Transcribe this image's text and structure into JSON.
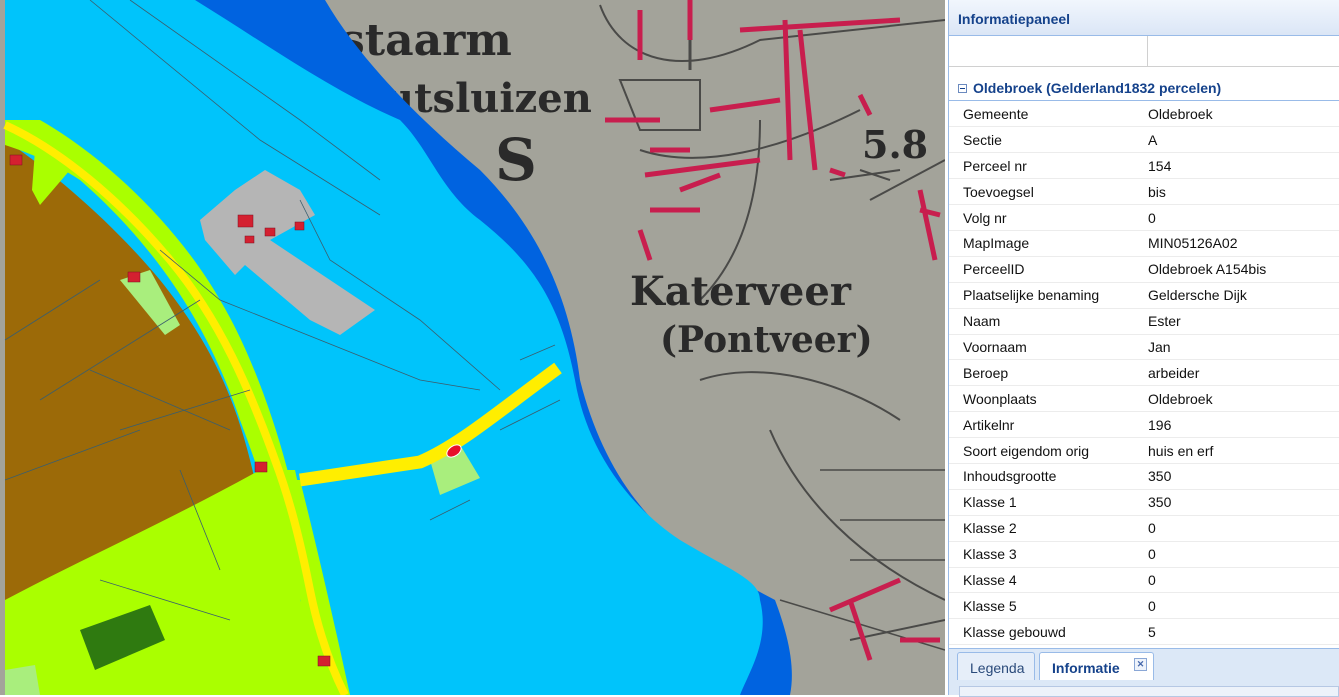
{
  "panel": {
    "title": "Informatiepaneel",
    "group_title": "Oldebroek (Gelderland1832 percelen)",
    "rows": [
      {
        "key": "Gemeente",
        "value": "Oldebroek"
      },
      {
        "key": "Sectie",
        "value": "A"
      },
      {
        "key": "Perceel nr",
        "value": "154"
      },
      {
        "key": "Toevoegsel",
        "value": "bis"
      },
      {
        "key": "Volg nr",
        "value": "0"
      },
      {
        "key": "MapImage",
        "value": "MIN05126A02"
      },
      {
        "key": "PerceelID",
        "value": "Oldebroek A154bis"
      },
      {
        "key": "Plaatselijke benaming",
        "value": "Geldersche Dijk"
      },
      {
        "key": "Naam",
        "value": "Ester"
      },
      {
        "key": "Voornaam",
        "value": "Jan"
      },
      {
        "key": "Beroep",
        "value": "arbeider"
      },
      {
        "key": "Woonplaats",
        "value": "Oldebroek"
      },
      {
        "key": "Artikelnr",
        "value": "196"
      },
      {
        "key": "Soort eigendom orig",
        "value": "huis en erf"
      },
      {
        "key": "Inhoudsgrootte",
        "value": "350"
      },
      {
        "key": "Klasse 1",
        "value": "350"
      },
      {
        "key": "Klasse 2",
        "value": "0"
      },
      {
        "key": "Klasse 3",
        "value": "0"
      },
      {
        "key": "Klasse 4",
        "value": "0"
      },
      {
        "key": "Klasse 5",
        "value": "0"
      },
      {
        "key": "Klasse gebouwd",
        "value": "5"
      }
    ]
  },
  "tabs": {
    "legenda": "Legenda",
    "informatie": "Informatie",
    "close_icon": "close-icon"
  },
  "map": {
    "labels": {
      "top_left": "staarm",
      "sluizen": "utsluizen",
      "letter": "S",
      "number": "5.8",
      "place1": "Katerveer",
      "place2": "(Pontveer)"
    },
    "colors": {
      "water": "#00c4fb",
      "river": "#0063e0",
      "road": "#ffee00",
      "farmland": "#9c6a08",
      "grassland": "#aaff00",
      "yard": "#a9ee7d",
      "built": "#b5b5b5",
      "building": "#d42030",
      "forest": "#2f7a10",
      "old_map": "#a3a39a"
    }
  }
}
